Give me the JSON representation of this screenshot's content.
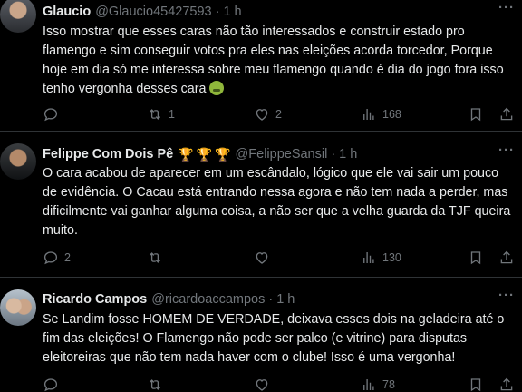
{
  "tweets": [
    {
      "name": "Glaucio",
      "handle": "@Glaucio45427593",
      "time": "1 h",
      "text": "Isso mostrar que esses caras não tão interessados e construir estado pro flamengo e sim conseguir votos pra eles nas eleições acorda torcedor, Porque  hoje em dia só me interessa sobre meu flamengo quando é dia do jogo fora isso tenho vergonha desses cara",
      "emoji": "nauseated-face",
      "replies": "",
      "retweets": "1",
      "likes": "2",
      "views": "168"
    },
    {
      "name": "Felippe Com Dois Pê",
      "badges": [
        "🏆",
        "🏆",
        "🏆"
      ],
      "handle": "@FelippeSansil",
      "time": "1 h",
      "text": "O cara acabou de aparecer em um escândalo, lógico que ele vai sair um pouco de evidência. O Cacau está entrando nessa agora e não tem nada a perder, mas dificilmente vai ganhar alguma coisa, a não ser que a velha guarda da TJF queira muito.",
      "replies": "2",
      "retweets": "",
      "likes": "",
      "views": "130"
    },
    {
      "name": "Ricardo Campos",
      "handle": "@ricardoaccampos",
      "time": "1 h",
      "text": "Se Landim fosse HOMEM DE VERDADE, deixava esses dois na geladeira até o fim das eleições! O Flamengo não pode ser palco (e vitrine) para disputas eleitoreiras que não tem nada haver com o clube! Isso é uma vergonha!",
      "replies": "",
      "retweets": "",
      "likes": "",
      "views": "78"
    }
  ],
  "colors": {
    "background": "#000000",
    "text": "#e7e9ea",
    "muted": "#71767b",
    "divider": "#2f3336"
  }
}
